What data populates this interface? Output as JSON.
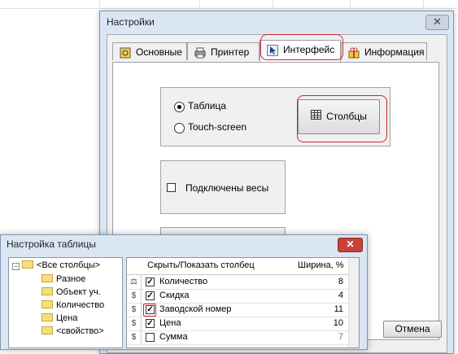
{
  "settings_window": {
    "title": "Настройки",
    "close_symbol": "✕",
    "tabs": [
      {
        "label": "Основные",
        "icon": "gear-icon"
      },
      {
        "label": "Принтер",
        "icon": "printer-icon"
      },
      {
        "label": "Интерфейс",
        "icon": "cursor-icon",
        "active": true
      },
      {
        "label": "Информация",
        "icon": "info-icon"
      }
    ],
    "view_mode": {
      "options": [
        "Таблица",
        "Touch-screen"
      ],
      "selected": "Таблица"
    },
    "columns_button": "Столбцы",
    "scales_checkbox": {
      "label": "Подключены весы",
      "checked": false
    },
    "cancel_button": "Отмена"
  },
  "table_window": {
    "title": "Настройка таблицы",
    "close_symbol": "✕",
    "tree": {
      "root": "<Все столбцы>",
      "children": [
        "Разное",
        "Объект уч.",
        "Количество",
        "Цена",
        "<свойство>"
      ]
    },
    "columns_header": {
      "name": "Скрыть/Показать столбец",
      "width": "Ширина, %"
    },
    "rows": [
      {
        "icon": "scale-icon",
        "name": "Количество",
        "checked": true,
        "width": "8"
      },
      {
        "icon": "coin-icon",
        "name": "Скидка",
        "checked": true,
        "width": "4"
      },
      {
        "icon": "coin-icon",
        "name": "Заводской номер",
        "checked": true,
        "width": "11"
      },
      {
        "icon": "coin-icon",
        "name": "Цена",
        "checked": true,
        "width": "10"
      },
      {
        "icon": "coin-icon",
        "name": "Сумма",
        "checked": false,
        "width": "7"
      }
    ]
  },
  "colors": {
    "highlight": "#d0242c",
    "window_frame": "#dbe6f4"
  }
}
